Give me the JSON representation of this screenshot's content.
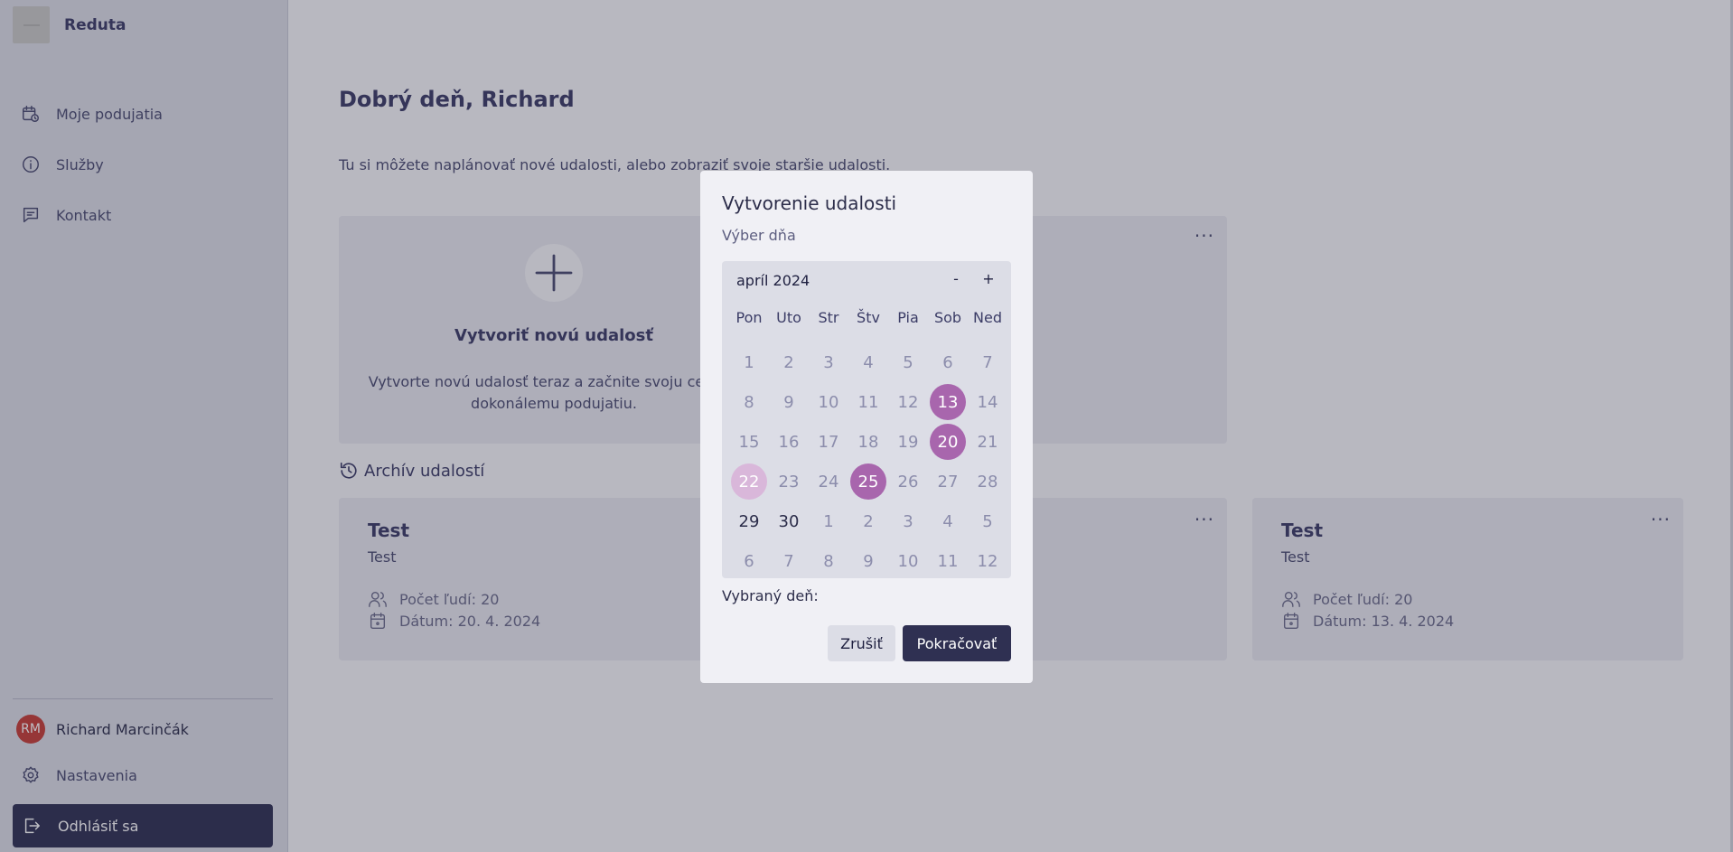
{
  "app": {
    "name": "Reduta"
  },
  "sidebar": {
    "items": [
      {
        "label": "Moje podujatia",
        "icon": "calendar-clock-icon"
      },
      {
        "label": "Služby",
        "icon": "info-icon"
      },
      {
        "label": "Kontakt",
        "icon": "message-icon"
      }
    ],
    "user": {
      "initials": "RM",
      "name": "Richard Marcinčák"
    },
    "settings_label": "Nastavenia",
    "logout_label": "Odhlásiť sa"
  },
  "main": {
    "greeting": "Dobrý deň, Richard",
    "subtitle": "Tu si môžete naplánovať nové udalosti, alebo zobraziť svoje staršie udalosti.",
    "create_card": {
      "title": "Vytvoriť novú udalosť",
      "description": "Vytvorte novú udalosť teraz a začnite svoju cestu k dokonálemu podujatiu."
    },
    "archive_title": "Archív udalostí",
    "events": [
      {
        "title": "Test",
        "subtitle": "Test",
        "people": "Počet ľudí: 20",
        "date": "Dátum: 20. 4. 2024"
      },
      {
        "title": "Test",
        "subtitle": "Test",
        "people": "Počet ľudí: 20",
        "date": "Dátum: 13. 4. 2024"
      }
    ],
    "more_label": "···"
  },
  "modal": {
    "title": "Vytvorenie udalosti",
    "subtitle": "Výber dňa",
    "calendar": {
      "month_label": "apríl 2024",
      "prev_label": "-",
      "next_label": "+",
      "weekdays": [
        "Pon",
        "Uto",
        "Str",
        "Štv",
        "Pia",
        "Sob",
        "Ned"
      ],
      "days": [
        [
          "1",
          "2",
          "3",
          "4",
          "5",
          "6",
          "7"
        ],
        [
          "8",
          "9",
          "10",
          "11",
          "12",
          "13",
          "14"
        ],
        [
          "15",
          "16",
          "17",
          "18",
          "19",
          "20",
          "21"
        ],
        [
          "22",
          "23",
          "24",
          "25",
          "26",
          "27",
          "28"
        ],
        [
          "29",
          "30",
          "1",
          "2",
          "3",
          "4",
          "5"
        ],
        [
          "6",
          "7",
          "8",
          "9",
          "10",
          "11",
          "12"
        ]
      ],
      "state": [
        [
          "past",
          "past",
          "past",
          "past",
          "past",
          "past",
          "past"
        ],
        [
          "past",
          "past",
          "past",
          "past",
          "past",
          "busy",
          "past"
        ],
        [
          "past",
          "past",
          "past",
          "past",
          "past",
          "busy",
          "past"
        ],
        [
          "today",
          "past",
          "past",
          "busy",
          "past",
          "past",
          "past"
        ],
        [
          "cur",
          "cur",
          "other",
          "other",
          "other",
          "other",
          "other"
        ],
        [
          "other",
          "other",
          "other",
          "other",
          "other",
          "other",
          "other"
        ]
      ]
    },
    "selected_label": "Vybraný deň:",
    "cancel_label": "Zrušiť",
    "continue_label": "Pokračovať"
  },
  "colors": {
    "primary": "#2f3052",
    "booked_day": "#a866ad",
    "today_day": "#d9b7da",
    "avatar": "#c63d35"
  }
}
